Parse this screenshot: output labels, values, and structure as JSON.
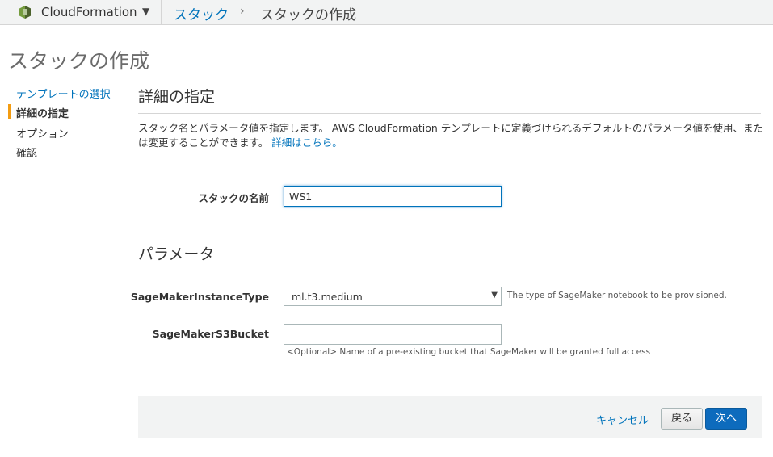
{
  "topbar": {
    "service_name": "CloudFormation",
    "breadcrumb_link": "スタック",
    "breadcrumb_separator": "›",
    "breadcrumb_current": "スタックの作成"
  },
  "page": {
    "title": "スタックの作成"
  },
  "nav": {
    "items": [
      {
        "label": "テンプレートの選択",
        "state": "link"
      },
      {
        "label": "詳細の指定",
        "state": "active"
      },
      {
        "label": "オプション",
        "state": "plain"
      },
      {
        "label": "確認",
        "state": "plain"
      }
    ]
  },
  "details": {
    "title": "詳細の指定",
    "description": "スタック名とパラメータ値を指定します。 AWS CloudFormation テンプレートに定義づけられるデフォルトのパラメータ値を使用、または変更することができます。",
    "learn_more": "詳細はこちら。",
    "stack_name_label": "スタックの名前",
    "stack_name_value": "WS1"
  },
  "parameters": {
    "title": "パラメータ",
    "instance_type_label": "SageMakerInstanceType",
    "instance_type_value": "ml.t3.medium",
    "instance_type_hint": "The type of SageMaker notebook to be provisioned.",
    "bucket_label": "SageMakerS3Bucket",
    "bucket_value": "",
    "bucket_hint": "<Optional> Name of a pre-existing bucket that SageMaker will be granted full access"
  },
  "footer": {
    "cancel_label": "キャンセル",
    "back_label": "戻る",
    "next_label": "次へ"
  },
  "colors": {
    "link": "#0073bb",
    "nav_active_bar": "#f39c12",
    "primary_button": "#0d6bbd"
  }
}
